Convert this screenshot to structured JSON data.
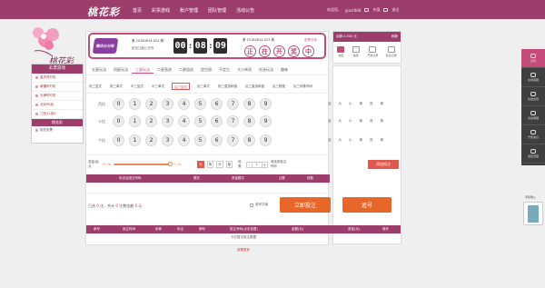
{
  "brand": {
    "logo_text": "桃花彩",
    "deco_text": "桃花彩",
    "accent": "#9c3d6b",
    "pink": "#c44b7a",
    "orange": "#e8662a",
    "red": "#e2574c"
  },
  "topnav": {
    "items": [
      "首页",
      "彩票游戏",
      "账户管理",
      "团队管理",
      "活动公告"
    ]
  },
  "user": {
    "greeting": "欢迎您，",
    "name": "giast888",
    "actions": [
      "充值",
      "退出"
    ]
  },
  "leftmenu": {
    "title": "彩票游戏",
    "items": [
      "重庆时时彩",
      "新疆时时彩",
      "天津时时彩",
      "北京PK拾",
      "江西11选5"
    ],
    "brand": "桃花彩",
    "sub": "桃花彩票"
  },
  "lottery": {
    "logo": "腾讯分分彩",
    "current_period": "第 20180614-024 期",
    "current_status": "距投注截止还有",
    "timer": {
      "h": "00",
      "m": "08",
      "s": "09"
    },
    "last_period": "第 20180614-023 期",
    "trend_link": "走势分析",
    "result": [
      "正",
      "在",
      "开",
      "奖",
      "中"
    ]
  },
  "account": {
    "label": "余额 0.000 元",
    "refresh": "刷新",
    "items": [
      "充值",
      "提现",
      "开奖记录",
      "投注记录"
    ]
  },
  "play_tabs": [
    "五星玩法",
    "四星玩法",
    "三星玩法",
    "二星直选",
    "二星组选",
    "定位胆",
    "不定位",
    "大小单双",
    "任选玩法",
    "趣味"
  ],
  "play_tab_active": 2,
  "sub_tabs": [
    "前三复式",
    "前三单式",
    "中三复式",
    "中三单式",
    "后三复式",
    "后三单式",
    "前三直选和值",
    "后三直选和值",
    "后三跨度",
    "后三特殊号码"
  ],
  "sub_tab_active": 4,
  "digit_rows": [
    {
      "label": "百位",
      "digits": [
        "0",
        "1",
        "2",
        "3",
        "4",
        "5",
        "6",
        "7",
        "8",
        "9"
      ]
    },
    {
      "label": "十位",
      "digits": [
        "0",
        "1",
        "2",
        "3",
        "4",
        "5",
        "6",
        "7",
        "8",
        "9"
      ]
    },
    {
      "label": "个位",
      "digits": [
        "0",
        "1",
        "2",
        "3",
        "4",
        "5",
        "6",
        "7",
        "8",
        "9"
      ]
    }
  ],
  "filters": [
    "全",
    "大",
    "小",
    "单",
    "双",
    "清"
  ],
  "betting": {
    "rebate_label": "奖金/返点",
    "rebate_value": "19.58",
    "rebate_pct": "0.0%",
    "units": [
      "元",
      "角",
      "分",
      "厘"
    ],
    "unit_active": 0,
    "multiple_label": "倍数",
    "multiple_value": "1",
    "select_hint": "请选择投注号码",
    "add_button": "添加投注"
  },
  "cart_headers": [
    "玩法及投注号码",
    "模式",
    "资金模式",
    "注数",
    "倍数",
    "金额"
  ],
  "summary": {
    "prefix": "已选",
    "notes": "0",
    "mid": "注，共计",
    "total": "0",
    "mid2": "注数金额",
    "amount": "0",
    "suffix": "元"
  },
  "trace_label": "追号方案",
  "order_button": "立即投注",
  "chase_button": "追号",
  "record_headers": [
    "单号",
    "投注时间",
    "彩种",
    "玩法",
    "期号",
    "投注号码(点击查看)",
    "金额(元)",
    "奖金(元)",
    "操作"
  ],
  "no_data": "今日暂无投注数据",
  "more": "查看更多",
  "sidebar": [
    "在线客服",
    "在线充值",
    "资金明细",
    "开奖信息",
    "返回顶部"
  ],
  "sidebar_top": "充值",
  "phone_label": "手机购入"
}
